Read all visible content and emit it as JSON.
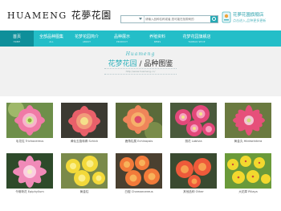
{
  "header": {
    "logo_en": "HUAMENG",
    "logo_cn": "花夢花園",
    "search": {
      "select_value": "",
      "placeholder": "请输入品种名称或者,您可能在找带刺的"
    },
    "store": {
      "line1": "花夢花園旗舰店",
      "line2": "点击进入,品种更多更新"
    }
  },
  "nav": {
    "items": [
      {
        "cn": "首页",
        "en": "HOME",
        "active": true
      },
      {
        "cn": "全部品种图集",
        "en": "ALL",
        "active": false
      },
      {
        "cn": "花梦花园简介",
        "en": "ABOUT",
        "active": false
      },
      {
        "cn": "品种展示",
        "en": "PRODUCT",
        "active": false
      },
      {
        "cn": "养殖资料",
        "en": "NEWS",
        "active": false
      },
      {
        "cn": "花梦花园旗舰店",
        "en": "TAOBAO SHOP",
        "active": false
      }
    ]
  },
  "banner": {
    "script": "Huameng",
    "title_a": "花梦花园",
    "title_sep": "/",
    "title_b": "品种图鉴",
    "url": "http://www.huameng.cc/"
  },
  "gallery": {
    "items": [
      {
        "caption": "毛花柱 Trichocereus"
      },
      {
        "caption": "黄仙玉旋转卿 Schick"
      },
      {
        "caption": "鹿角柱属 Echinopsis"
      },
      {
        "caption": "丽花 Lobivia"
      },
      {
        "caption": "黄金丸 Hildewintera"
      },
      {
        "caption": "令箭荷花 Epiphyllum"
      },
      {
        "caption": "黄金柱"
      },
      {
        "caption": "白檀 Chamaecereus"
      },
      {
        "caption": "其他品种 Other"
      },
      {
        "caption": "大花犀 Piliaya"
      }
    ]
  },
  "colors": {
    "nav_bg": "#24bec8",
    "nav_active": "#0f8f9a",
    "accent": "#2eb1bb",
    "banner_bg": "#f1f1f1"
  }
}
